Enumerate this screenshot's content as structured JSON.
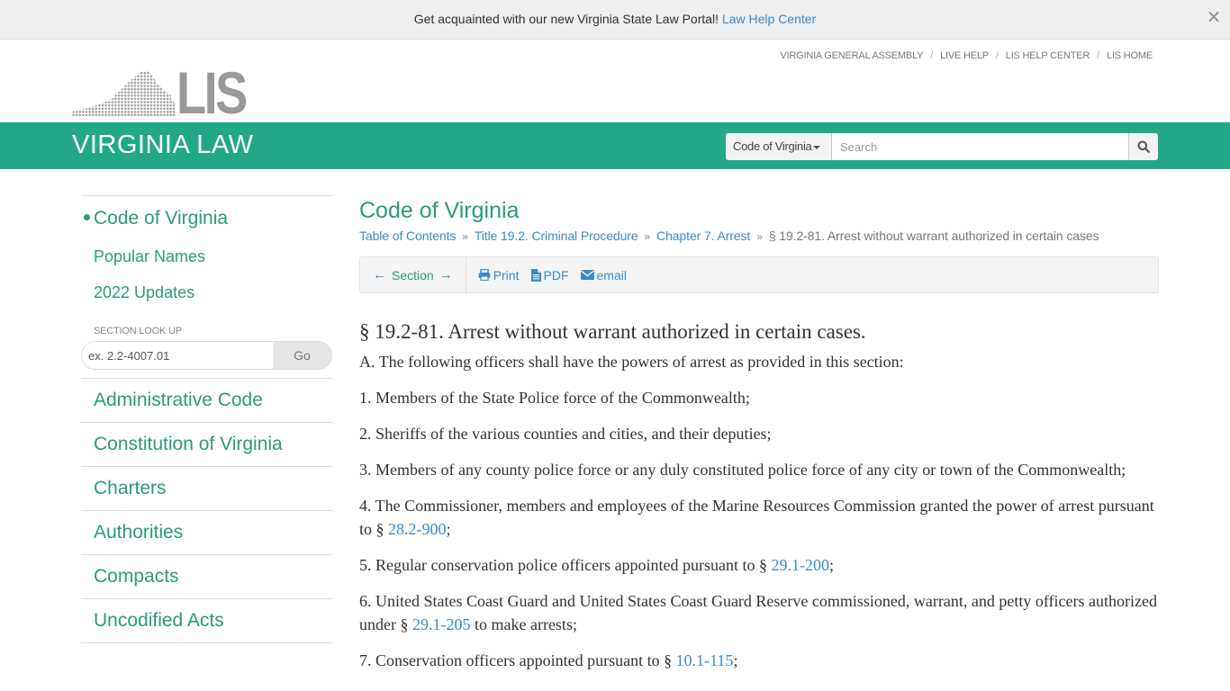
{
  "banner": {
    "text": "Get acquainted with our new Virginia State Law Portal!",
    "link": "Law Help Center",
    "close_icon": "×"
  },
  "topnav": {
    "items": [
      "VIRGINIA GENERAL ASSEMBLY",
      "LIVE HELP",
      "LIS HELP CENTER",
      "LIS HOME"
    ],
    "separator": "/"
  },
  "logo": {
    "text": "LIS"
  },
  "header": {
    "brand": "VIRGINIA LAW",
    "search_scope": "Code of Virginia",
    "search_placeholder": "Search",
    "search_value": ""
  },
  "sidebar": {
    "sub_items": [
      {
        "label": "Code of Virginia",
        "active": true
      },
      {
        "label": "Popular Names",
        "active": false
      },
      {
        "label": "2022 Updates",
        "active": false
      }
    ],
    "lookup_label": "SECTION LOOK UP",
    "lookup_placeholder": "ex. 2.2-4007.01",
    "lookup_go": "Go",
    "main_items": [
      "Administrative Code",
      "Constitution of Virginia",
      "Charters",
      "Authorities",
      "Compacts",
      "Uncodified Acts"
    ]
  },
  "content": {
    "title": "Code of Virginia",
    "breadcrumbs": [
      "Table of Contents",
      "Title 19.2. Criminal Procedure",
      "Chapter 7. Arrest"
    ],
    "breadcrumb_current": "§ 19.2-81. Arrest without warrant authorized in certain cases",
    "breadcrumb_sep": "»",
    "toolbar": {
      "section_label": "Section",
      "prev_arrow": "←",
      "next_arrow": "→",
      "print": "Print",
      "pdf": "PDF",
      "email": "email"
    },
    "section_title": "§ 19.2-81. Arrest without warrant authorized in certain cases.",
    "paragraphs": [
      {
        "pre": "A. The following officers shall have the powers of arrest as provided in this section:"
      },
      {
        "pre": "1. Members of the State Police force of the Commonwealth;"
      },
      {
        "pre": "2. Sheriffs of the various counties and cities, and their deputies;"
      },
      {
        "pre": "3. Members of any county police force or any duly constituted police force of any city or town of the Commonwealth;"
      },
      {
        "pre": "4. The Commissioner, members and employees of the Marine Resources Commission granted the power of arrest pursuant to § ",
        "link": "28.2-900",
        "post": ";"
      },
      {
        "pre": "5. Regular conservation police officers appointed pursuant to § ",
        "link": "29.1-200",
        "post": ";"
      },
      {
        "pre": "6. United States Coast Guard and United States Coast Guard Reserve commissioned, warrant, and petty officers authorized under § ",
        "link": "29.1-205",
        "post": " to make arrests;"
      },
      {
        "pre": "7. Conservation officers appointed pursuant to § ",
        "link": "10.1-115",
        "post": ";"
      }
    ]
  },
  "colors": {
    "brand_green": "#23a887",
    "link_green": "#2b9a7d",
    "link_blue": "#3a8bcb",
    "banner_bg": "#eeeeee"
  }
}
